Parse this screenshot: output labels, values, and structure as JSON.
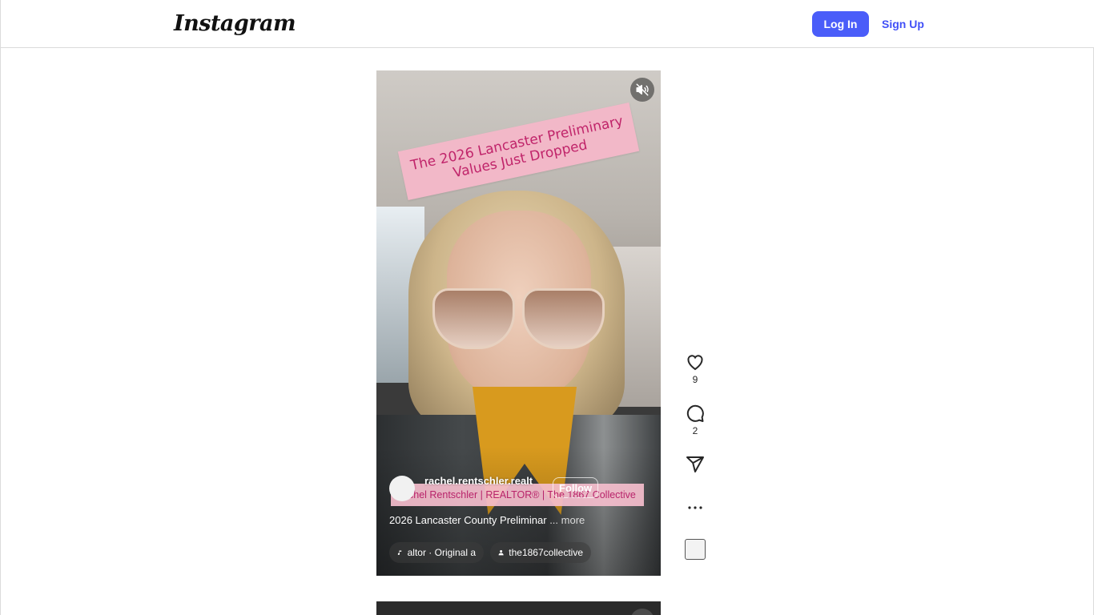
{
  "header": {
    "logo_text": "Instagram",
    "login_label": "Log In",
    "signup_label": "Sign Up"
  },
  "reel": {
    "sticker_line1": "The 2026 Lancaster Preliminary",
    "sticker_line2": "Values Just Dropped",
    "username": "rachel.rentschler.realt",
    "follow_label": "Follow",
    "banner_text": "chel Rentschler | REALTOR® | The 1867 Collective",
    "caption": "2026 Lancaster County Preliminar",
    "caption_more": "... more",
    "audio_label": "altor · Original a",
    "tagged_user": "the1867collective",
    "muted": true
  },
  "actions": {
    "likes": "9",
    "comments": "2"
  },
  "colors": {
    "accent": "#4a5df9",
    "signup": "#4150f7",
    "sticker_bg": "#f2b8c8",
    "sticker_text": "#c0246a"
  },
  "icons": [
    "volume-off-icon",
    "heart-icon",
    "comment-icon",
    "share-icon",
    "more-icon",
    "music-icon",
    "user-icon"
  ]
}
